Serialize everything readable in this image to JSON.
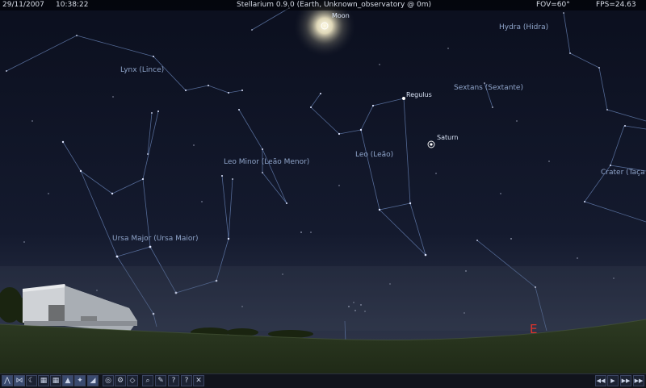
{
  "status_bar": {
    "date": "29/11/2007",
    "time": "10:38:22",
    "title": "Stellarium 0.9.0 (Earth, Unknown_observatory @ 0m)",
    "fov": "FOV=60°",
    "fps": "FPS=24.63"
  },
  "sky": {
    "constellations": {
      "lynx": "Lynx (Lince)",
      "hydra": "Hydra (Hidra)",
      "sextans": "Sextans (Sextante)",
      "leo_minor": "Leo Minor (Leão Menor)",
      "leo": "Leo (Leão)",
      "crater": "Crater (Taça",
      "ursa_major": "Ursa Major (Ursa Maior)"
    },
    "objects": {
      "moon": "Moon",
      "regulus": "Regulus",
      "saturn": "Saturn"
    },
    "cardinal": {
      "east": "E"
    }
  },
  "toolbar": {
    "left_buttons": [
      {
        "name": "constellation-lines-icon",
        "glyph": "⋀",
        "active": true
      },
      {
        "name": "constellation-names-icon",
        "glyph": "⋈",
        "active": true
      },
      {
        "name": "constellation-art-icon",
        "glyph": "☾",
        "active": false
      },
      {
        "name": "equatorial-grid-icon",
        "glyph": "▦",
        "active": false
      },
      {
        "name": "azimuthal-grid-icon",
        "glyph": "▦",
        "active": false
      },
      {
        "name": "ground-icon",
        "glyph": "▲",
        "active": true
      },
      {
        "name": "cardinal-points-icon",
        "glyph": "✦",
        "active": true
      },
      {
        "name": "atmosphere-icon",
        "glyph": "◢",
        "active": true
      },
      {
        "name": "nebula-icon",
        "glyph": "◎",
        "active": false
      },
      {
        "name": "equatorial-mount-icon",
        "glyph": "⚙",
        "active": false
      },
      {
        "name": "track-object-icon",
        "glyph": "◇",
        "active": false
      },
      {
        "name": "search-icon",
        "glyph": "⌕",
        "active": false
      },
      {
        "name": "configuration-icon",
        "glyph": "✎",
        "active": false
      },
      {
        "name": "help-icon",
        "glyph": "?",
        "active": false
      },
      {
        "name": "help-icon-2",
        "glyph": "?",
        "active": false
      },
      {
        "name": "quit-icon",
        "glyph": "✕",
        "active": false
      }
    ],
    "time_buttons": [
      {
        "name": "rewind-icon",
        "glyph": "◀◀"
      },
      {
        "name": "play-icon",
        "glyph": "▶"
      },
      {
        "name": "fast-forward-icon",
        "glyph": "▶▶"
      },
      {
        "name": "realtime-icon",
        "glyph": "▶▶"
      }
    ]
  }
}
